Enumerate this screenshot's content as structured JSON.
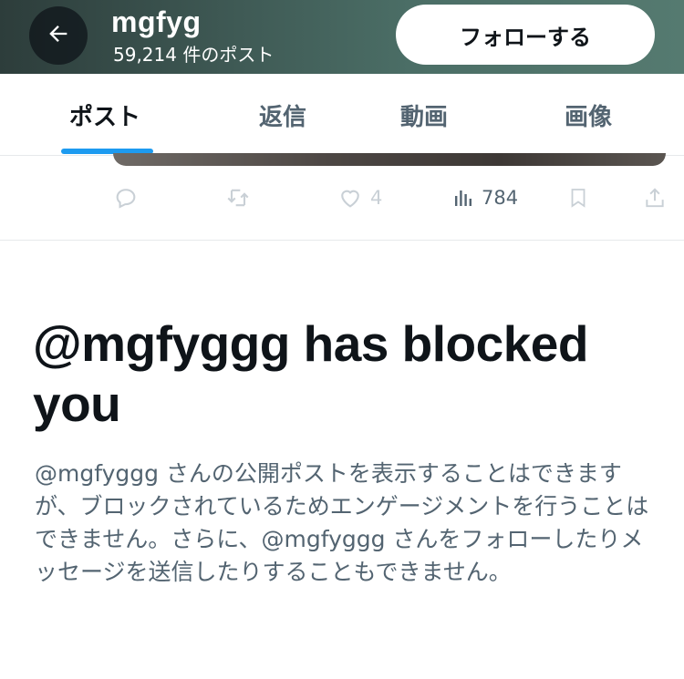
{
  "header": {
    "name": "mgfyg",
    "post_count": "59,214 件のポスト",
    "follow_label": "フォローする"
  },
  "tabs": [
    {
      "label": "ポスト",
      "active": true
    },
    {
      "label": "返信",
      "active": false
    },
    {
      "label": "動画",
      "active": false
    },
    {
      "label": "画像",
      "active": false
    }
  ],
  "post_actions": {
    "likes": "4",
    "views": "784"
  },
  "blocked": {
    "title": "@mgfyggg has blocked you",
    "body": "@mgfyggg さんの公開ポストを表示することはできますが、ブロックされているためエンゲージメントを行うことはできません。さらに、@mgfyggg さんをフォローしたりメッセージを送信したりすることもできません。"
  },
  "colors": {
    "accent": "#1d9bf0",
    "text_primary": "#0f1419",
    "text_secondary": "#536471"
  },
  "icons": [
    "back-arrow-icon",
    "reply-icon",
    "repost-icon",
    "like-icon",
    "views-icon",
    "bookmark-icon",
    "share-icon"
  ]
}
